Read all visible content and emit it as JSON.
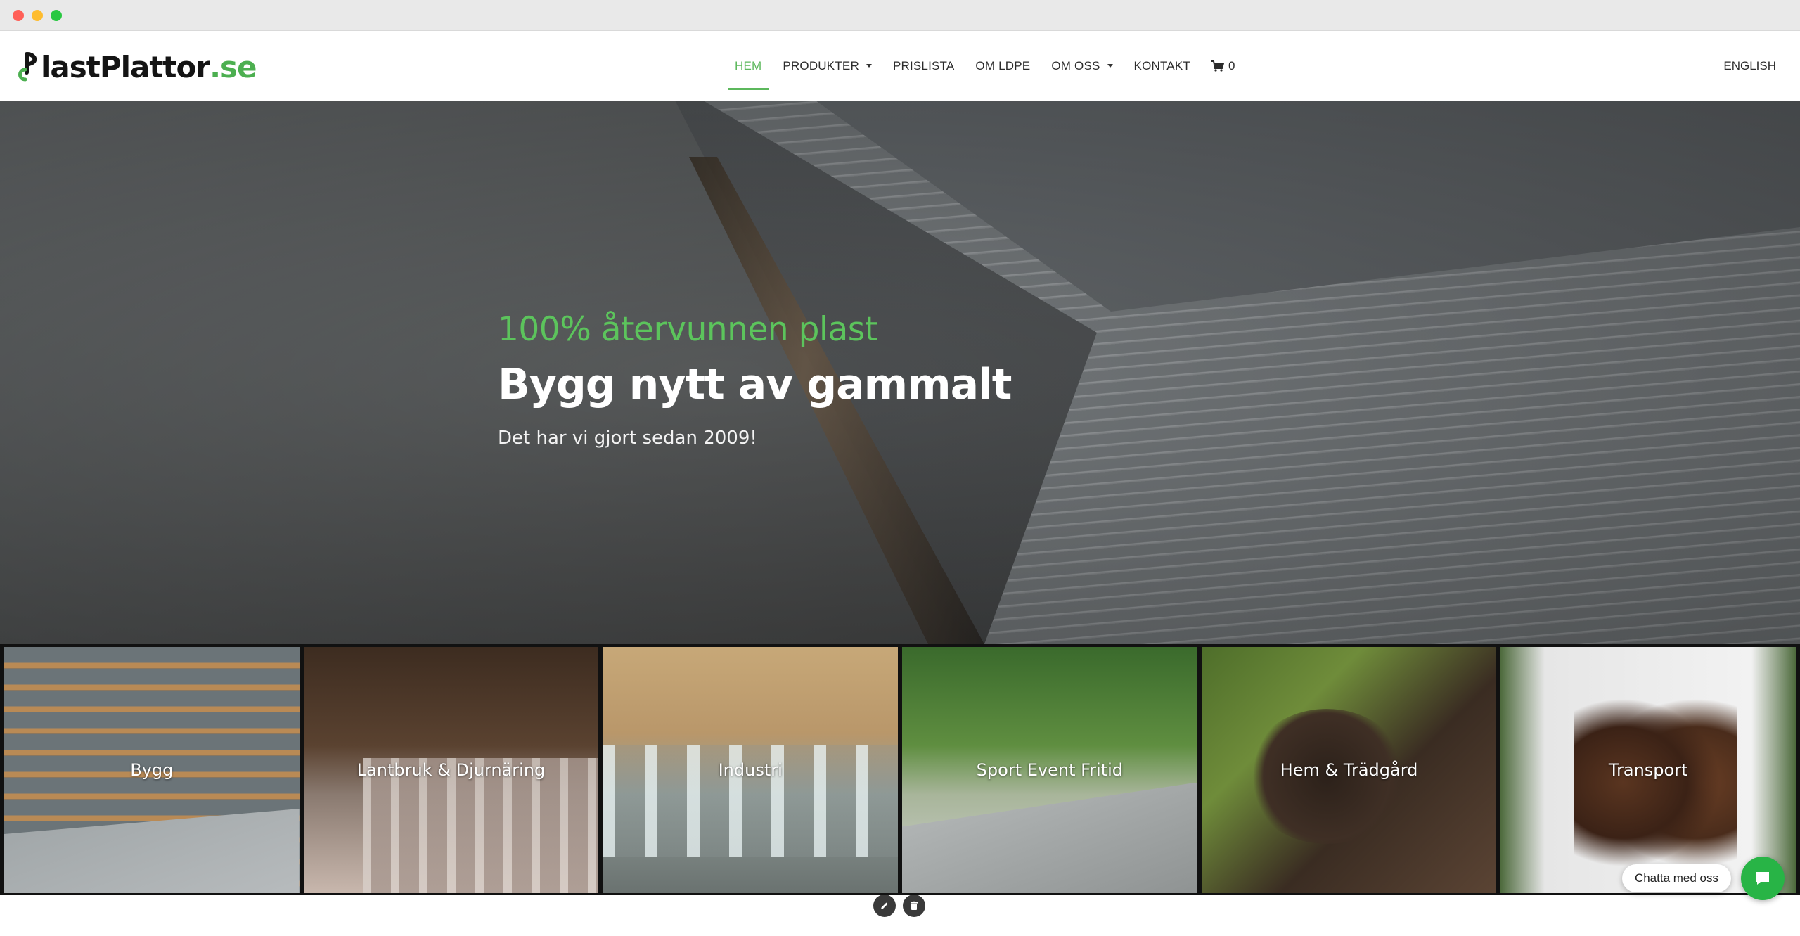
{
  "brand": {
    "logo_prefix": "lastPlattor",
    "logo_tld": ".se",
    "accent_color": "#5cb85c"
  },
  "nav": {
    "items": [
      {
        "label": "HEM",
        "active": true,
        "dropdown": false
      },
      {
        "label": "PRODUKTER",
        "active": false,
        "dropdown": true
      },
      {
        "label": "PRISLISTA",
        "active": false,
        "dropdown": false
      },
      {
        "label": "OM LDPE",
        "active": false,
        "dropdown": false
      },
      {
        "label": "OM OSS",
        "active": false,
        "dropdown": true
      },
      {
        "label": "KONTAKT",
        "active": false,
        "dropdown": false
      }
    ],
    "cart_icon": "cart-icon",
    "cart_count": "0",
    "language": "ENGLISH"
  },
  "hero": {
    "kicker": "100% återvunnen plast",
    "title": "Bygg nytt av gammalt",
    "subtitle": "Det har vi gjort sedan 2009!"
  },
  "categories": [
    {
      "label": "Bygg"
    },
    {
      "label": "Lantbruk & Djurnäring"
    },
    {
      "label": "Industri"
    },
    {
      "label": "Sport Event Fritid"
    },
    {
      "label": "Hem & Trädgård"
    },
    {
      "label": "Transport"
    }
  ],
  "edit_controls": {
    "edit_icon": "pencil-icon",
    "delete_icon": "trash-icon"
  },
  "chat": {
    "label": "Chatta med oss",
    "icon": "chat-bubble-icon",
    "color": "#28b446"
  }
}
